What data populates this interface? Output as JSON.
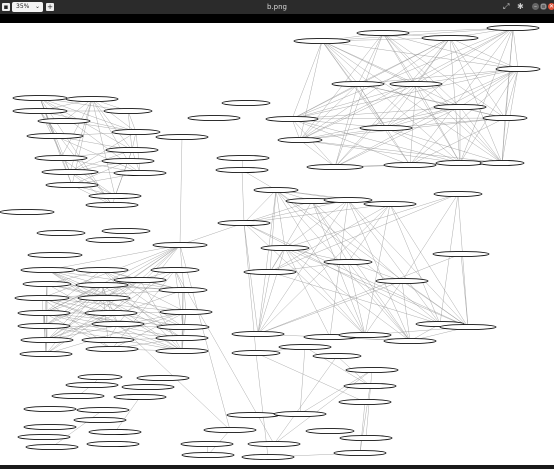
{
  "titlebar": {
    "title": "b.png",
    "zoom_value": "35%",
    "zoom_chevron": "⌄",
    "image_menu_glyph": "▪",
    "add_glyph": "+",
    "fullscreen_glyph": "⤢",
    "settings_glyph": "✱",
    "min_glyph": "–",
    "max_glyph": "▢",
    "close_glyph": "✕"
  },
  "icons": {
    "image_menu": "image-menu-icon",
    "add": "add-tab-icon",
    "fullscreen": "fullscreen-icon",
    "settings": "gear-icon",
    "minimize": "minimize-icon",
    "maximize": "maximize-icon",
    "close": "close-icon"
  },
  "colors": {
    "titlebar": "#2b2b2b",
    "close": "#e2573c",
    "edge": "#8a8a8a",
    "node_stroke": "#111111"
  }
}
